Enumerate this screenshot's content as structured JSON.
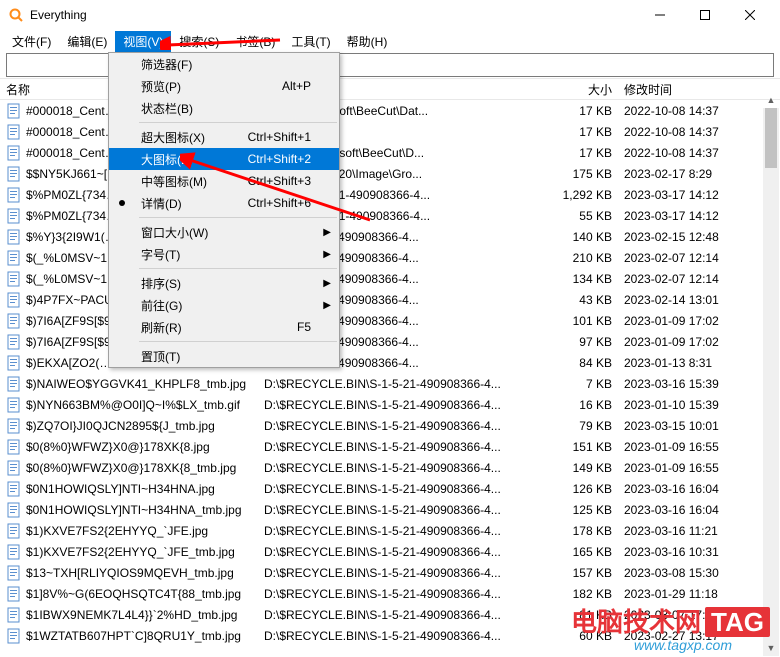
{
  "window": {
    "title": "Everything"
  },
  "menubar": [
    {
      "label": "文件(F)"
    },
    {
      "label": "编辑(E)"
    },
    {
      "label": "视图(V)",
      "open": true
    },
    {
      "label": "搜索(S)"
    },
    {
      "label": "书签(B)"
    },
    {
      "label": "工具(T)"
    },
    {
      "label": "帮助(H)"
    }
  ],
  "dropdown": [
    {
      "type": "item",
      "label": "筛选器(F)"
    },
    {
      "type": "item",
      "label": "预览(P)",
      "shortcut": "Alt+P"
    },
    {
      "type": "item",
      "label": "状态栏(B)"
    },
    {
      "type": "sep"
    },
    {
      "type": "item",
      "label": "超大图标(X)",
      "shortcut": "Ctrl+Shift+1"
    },
    {
      "type": "item",
      "label": "大图标(L)",
      "shortcut": "Ctrl+Shift+2",
      "hl": true
    },
    {
      "type": "item",
      "label": "中等图标(M)",
      "shortcut": "Ctrl+Shift+3"
    },
    {
      "type": "item",
      "label": "详情(D)",
      "shortcut": "Ctrl+Shift+6",
      "bullet": true
    },
    {
      "type": "sep"
    },
    {
      "type": "item",
      "label": "窗口大小(W)",
      "sub": true
    },
    {
      "type": "item",
      "label": "字号(T)",
      "sub": true
    },
    {
      "type": "sep"
    },
    {
      "type": "item",
      "label": "排序(S)",
      "sub": true
    },
    {
      "type": "item",
      "label": "前往(G)",
      "sub": true
    },
    {
      "type": "item",
      "label": "刷新(R)",
      "shortcut": "F5"
    },
    {
      "type": "sep"
    },
    {
      "type": "item",
      "label": "置顶(T)"
    }
  ],
  "columns": {
    "name": "名称",
    "size": "大小",
    "mtime": "修改时间"
  },
  "rows": [
    {
      "name": "#000018_Cent…",
      "path": "Data\\Apowersoft\\BeeCut\\Dat...",
      "size": "17 KB",
      "mtime": "2022-10-08 14:37"
    },
    {
      "name": "#000018_Cent…",
      "path": "",
      "size": "17 KB",
      "mtime": "2022-10-08 14:37"
    },
    {
      "name": "#000018_Cent…",
      "path": "Users\\Apowersoft\\BeeCut\\D...",
      "size": "17 KB",
      "mtime": "2022-10-08 14:37"
    },
    {
      "name": "$$NY5KJ661~[…",
      "path": "iles\\1989471620\\Image\\Gro...",
      "size": "175 KB",
      "mtime": "2023-02-17 8:29"
    },
    {
      "name": "$%PM0ZL{734…",
      "path": "E.BIN\\S-1-5-21-490908366-4...",
      "size": "1,292 KB",
      "mtime": "2023-03-17 14:12"
    },
    {
      "name": "$%PM0ZL{734…",
      "path": "E.BIN\\S-1-5-21-490908366-4...",
      "size": "55 KB",
      "mtime": "2023-03-17 14:12"
    },
    {
      "name": "$%Y}3{2I9W1(…",
      "path": "BIN\\S-1-5-21-490908366-4...",
      "size": "140 KB",
      "mtime": "2023-02-15 12:48"
    },
    {
      "name": "$(_%L0MSV~1…",
      "path": "BIN\\S-1-5-21-490908366-4...",
      "size": "210 KB",
      "mtime": "2023-02-07 12:14"
    },
    {
      "name": "$(_%L0MSV~1…",
      "path": "BIN\\S-1-5-21-490908366-4...",
      "size": "134 KB",
      "mtime": "2023-02-07 12:14"
    },
    {
      "name": "$)4P7FX~PACU…",
      "path": "BIN\\S-1-5-21-490908366-4...",
      "size": "43 KB",
      "mtime": "2023-02-14 13:01"
    },
    {
      "name": "$)7I6A[ZF9S[$9…",
      "path": "BIN\\S-1-5-21-490908366-4...",
      "size": "101 KB",
      "mtime": "2023-01-09 17:02"
    },
    {
      "name": "$)7I6A[ZF9S[$9…",
      "path": "BIN\\S-1-5-21-490908366-4...",
      "size": "97 KB",
      "mtime": "2023-01-09 17:02"
    },
    {
      "name": "$)EKXA[ZO2(…",
      "path": "BIN\\S-1-5-21-490908366-4...",
      "size": "84 KB",
      "mtime": "2023-01-13 8:31"
    },
    {
      "name": "$)NAIWEO$YGGVK41_KHPLF8_tmb.jpg",
      "path": "D:\\$RECYCLE.BIN\\S-1-5-21-490908366-4...",
      "size": "7 KB",
      "mtime": "2023-03-16 15:39"
    },
    {
      "name": "$)NYN663BM%@O0I]Q~I%$LX_tmb.gif",
      "path": "D:\\$RECYCLE.BIN\\S-1-5-21-490908366-4...",
      "size": "16 KB",
      "mtime": "2023-01-10 15:39"
    },
    {
      "name": "$)ZQ7OI}JI0QJCN2895${J_tmb.jpg",
      "path": "D:\\$RECYCLE.BIN\\S-1-5-21-490908366-4...",
      "size": "79 KB",
      "mtime": "2023-03-15 10:01"
    },
    {
      "name": "$0(8%0}WFWZ}X0@}178XK{8.jpg",
      "path": "D:\\$RECYCLE.BIN\\S-1-5-21-490908366-4...",
      "size": "151 KB",
      "mtime": "2023-01-09 16:55"
    },
    {
      "name": "$0(8%0}WFWZ}X0@}178XK{8_tmb.jpg",
      "path": "D:\\$RECYCLE.BIN\\S-1-5-21-490908366-4...",
      "size": "149 KB",
      "mtime": "2023-01-09 16:55"
    },
    {
      "name": "$0N1HOWIQSLY]NTI~H34HNA.jpg",
      "path": "D:\\$RECYCLE.BIN\\S-1-5-21-490908366-4...",
      "size": "126 KB",
      "mtime": "2023-03-16 16:04"
    },
    {
      "name": "$0N1HOWIQSLY]NTI~H34HNA_tmb.jpg",
      "path": "D:\\$RECYCLE.BIN\\S-1-5-21-490908366-4...",
      "size": "125 KB",
      "mtime": "2023-03-16 16:04"
    },
    {
      "name": "$1)KXVE7FS2{2EHYYQ_`JFE.jpg",
      "path": "D:\\$RECYCLE.BIN\\S-1-5-21-490908366-4...",
      "size": "178 KB",
      "mtime": "2023-03-16 11:21"
    },
    {
      "name": "$1)KXVE7FS2{2EHYYQ_`JFE_tmb.jpg",
      "path": "D:\\$RECYCLE.BIN\\S-1-5-21-490908366-4...",
      "size": "165 KB",
      "mtime": "2023-03-16 10:31"
    },
    {
      "name": "$13~TXH[RLIYQIOS9MQEVH_tmb.jpg",
      "path": "D:\\$RECYCLE.BIN\\S-1-5-21-490908366-4...",
      "size": "157 KB",
      "mtime": "2023-03-08 15:30"
    },
    {
      "name": "$1]8V%~G(6EOQHSQTC4T{88_tmb.jpg",
      "path": "D:\\$RECYCLE.BIN\\S-1-5-21-490908366-4...",
      "size": "182 KB",
      "mtime": "2023-01-29 11:18"
    },
    {
      "name": "$1IBWX9NEMK7L4L4}}`2%HD_tmb.jpg",
      "path": "D:\\$RECYCLE.BIN\\S-1-5-21-490908366-4...",
      "size": "81 KB",
      "mtime": "2023-03-07 17:37"
    },
    {
      "name": "$1WZTATB607HPT`C]8QRU1Y_tmb.jpg",
      "path": "D:\\$RECYCLE.BIN\\S-1-5-21-490908366-4...",
      "size": "60 KB",
      "mtime": "2023-02-27 13:17"
    }
  ],
  "watermark": {
    "text1": "电脑技术网",
    "text2": "TAG",
    "url": "www.tagxp.com"
  }
}
